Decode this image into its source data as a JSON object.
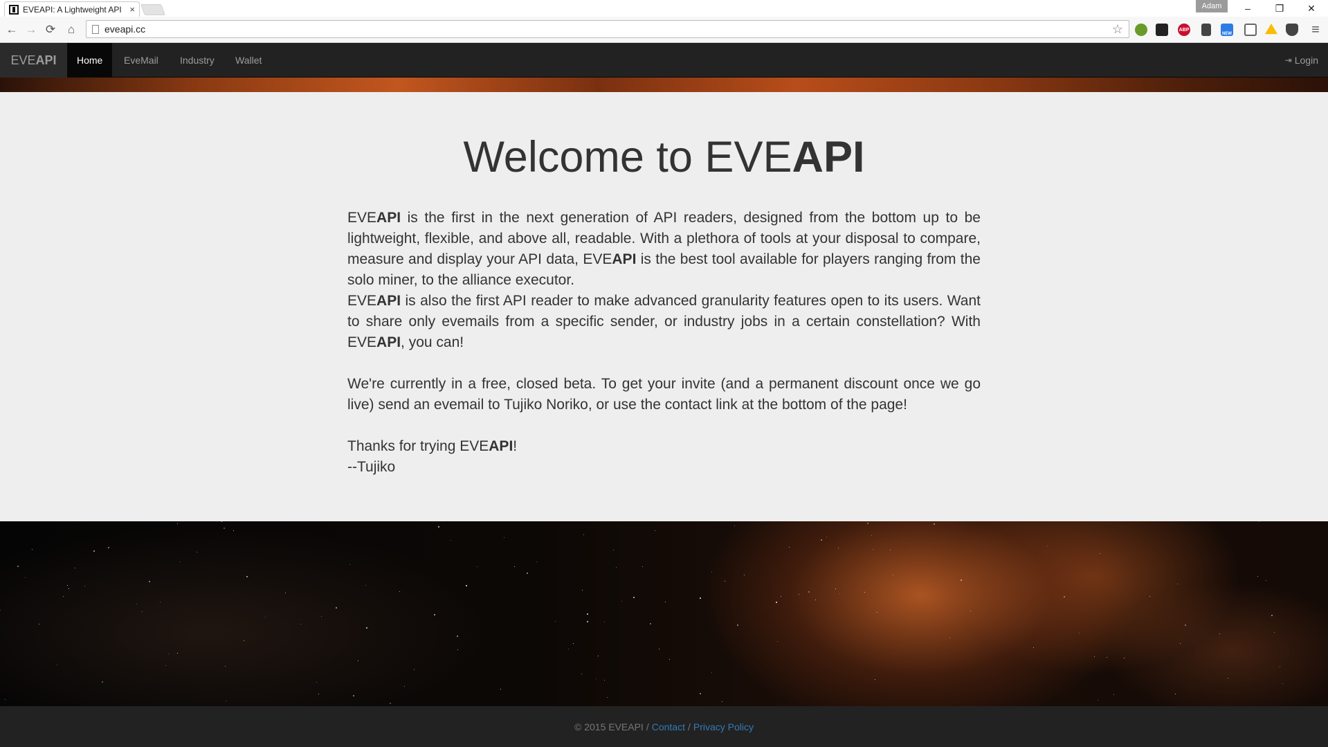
{
  "browser": {
    "tab_title": "EVEAPI: A Lightweight API",
    "tab_close": "×",
    "profile_name": "Adam",
    "url": "eveapi.cc",
    "window_controls": {
      "minimize": "–",
      "restore": "❐",
      "close": "✕"
    },
    "nav_icons": {
      "back": "←",
      "forward": "→",
      "reload": "⟳",
      "home": "⌂",
      "star": "☆",
      "menu": "≡"
    },
    "extensions": [
      "shield-extension",
      "d-extension",
      "abp-extension",
      "pen-extension",
      "new-extension",
      "cast-extension",
      "drive-extension",
      "pocket-extension"
    ],
    "extension_labels": {
      "abp": "ABP",
      "new": "NEW"
    }
  },
  "navbar": {
    "brand_prefix": "EVE",
    "brand_suffix": "API",
    "links": [
      {
        "label": "Home",
        "active": true
      },
      {
        "label": "EveMail",
        "active": false
      },
      {
        "label": "Industry",
        "active": false
      },
      {
        "label": "Wallet",
        "active": false
      }
    ],
    "login_icon": "⇥",
    "login_label": "Login"
  },
  "hero": {
    "title_prefix": "Welcome to EVE",
    "title_suffix": "API"
  },
  "content": {
    "brand_prefix": "EVE",
    "brand_suffix": "API",
    "p1": " is the first in the next generation of API readers, designed from the bottom up to be lightweight, flexible, and above all, readable. With a plethora of tools at your disposal to compare, measure and display your API data, ",
    "p1b": " is the best tool available for players ranging from the solo miner, to the alliance executor.",
    "p2": " is also the first API reader to make advanced granularity features open to its users. Want to share only evemails from a specific sender, or industry jobs in a certain constellation? With ",
    "p2b": ", you can!",
    "p3": "We're currently in a free, closed beta. To get your invite (and a permanent discount once we go live) send an evemail to Tujiko Noriko, or use the contact link at the bottom of the page!",
    "thanks_prefix": "Thanks for trying ",
    "thanks_suffix": "!",
    "signature": "--Tujiko"
  },
  "footer": {
    "copyright": "© 2015 EVEAPI",
    "separator": "/",
    "contact": "Contact",
    "privacy": "Privacy Policy"
  },
  "colors": {
    "navbar_bg": "#222222",
    "active_nav_bg": "#080808",
    "jumbotron_bg": "#eeeeee",
    "text": "#333333",
    "link": "#337ab7",
    "muted": "#9d9d9d"
  }
}
